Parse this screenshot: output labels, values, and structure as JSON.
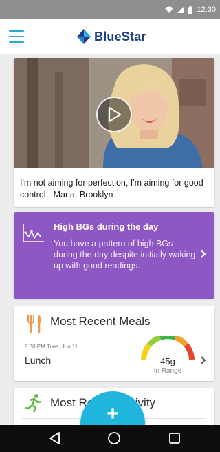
{
  "status_bar": {
    "time": "12:30",
    "icons": [
      "wifi-icon",
      "cell-signal-icon",
      "battery-icon"
    ]
  },
  "app_bar": {
    "menu_icon": "hamburger-menu-icon",
    "logo_icon": "bluestar-diamond-icon",
    "logo_text": "BlueStar"
  },
  "video_card": {
    "play_icon": "play-icon",
    "quote": "I'm not aiming for perfection, I'm aiming for good control - Maria, Brooklyn"
  },
  "insight_card": {
    "icon": "bg-trend-chart-icon",
    "title": "High BGs during the day",
    "body": "You have a pattern of high BGs during the day despite initially waking up with good readings.",
    "color": "#8f57c4"
  },
  "meals_card": {
    "icon": "fork-knife-icon",
    "heading": "Most Recent Meals",
    "meal_time": "8:30 PM Tues, Jun 11",
    "meal_name": "Lunch",
    "carbs": "45g",
    "status": "In Range",
    "gauge_level": 0.6,
    "gauge_colors": [
      "#f2d21b",
      "#9acb3c",
      "#3fb24a",
      "#f4a02a",
      "#e2462f"
    ]
  },
  "activity_card": {
    "icon": "runner-icon",
    "heading": "Most Recent Activity"
  },
  "fab": {
    "label": "+",
    "color": "#1fb5dd"
  },
  "nav_bar": {
    "icons": [
      "back-triangle-icon",
      "home-circle-icon",
      "recents-square-icon"
    ]
  },
  "colors": {
    "brand_blue": "#1d3f87",
    "accent_cyan": "#29a6dd"
  }
}
